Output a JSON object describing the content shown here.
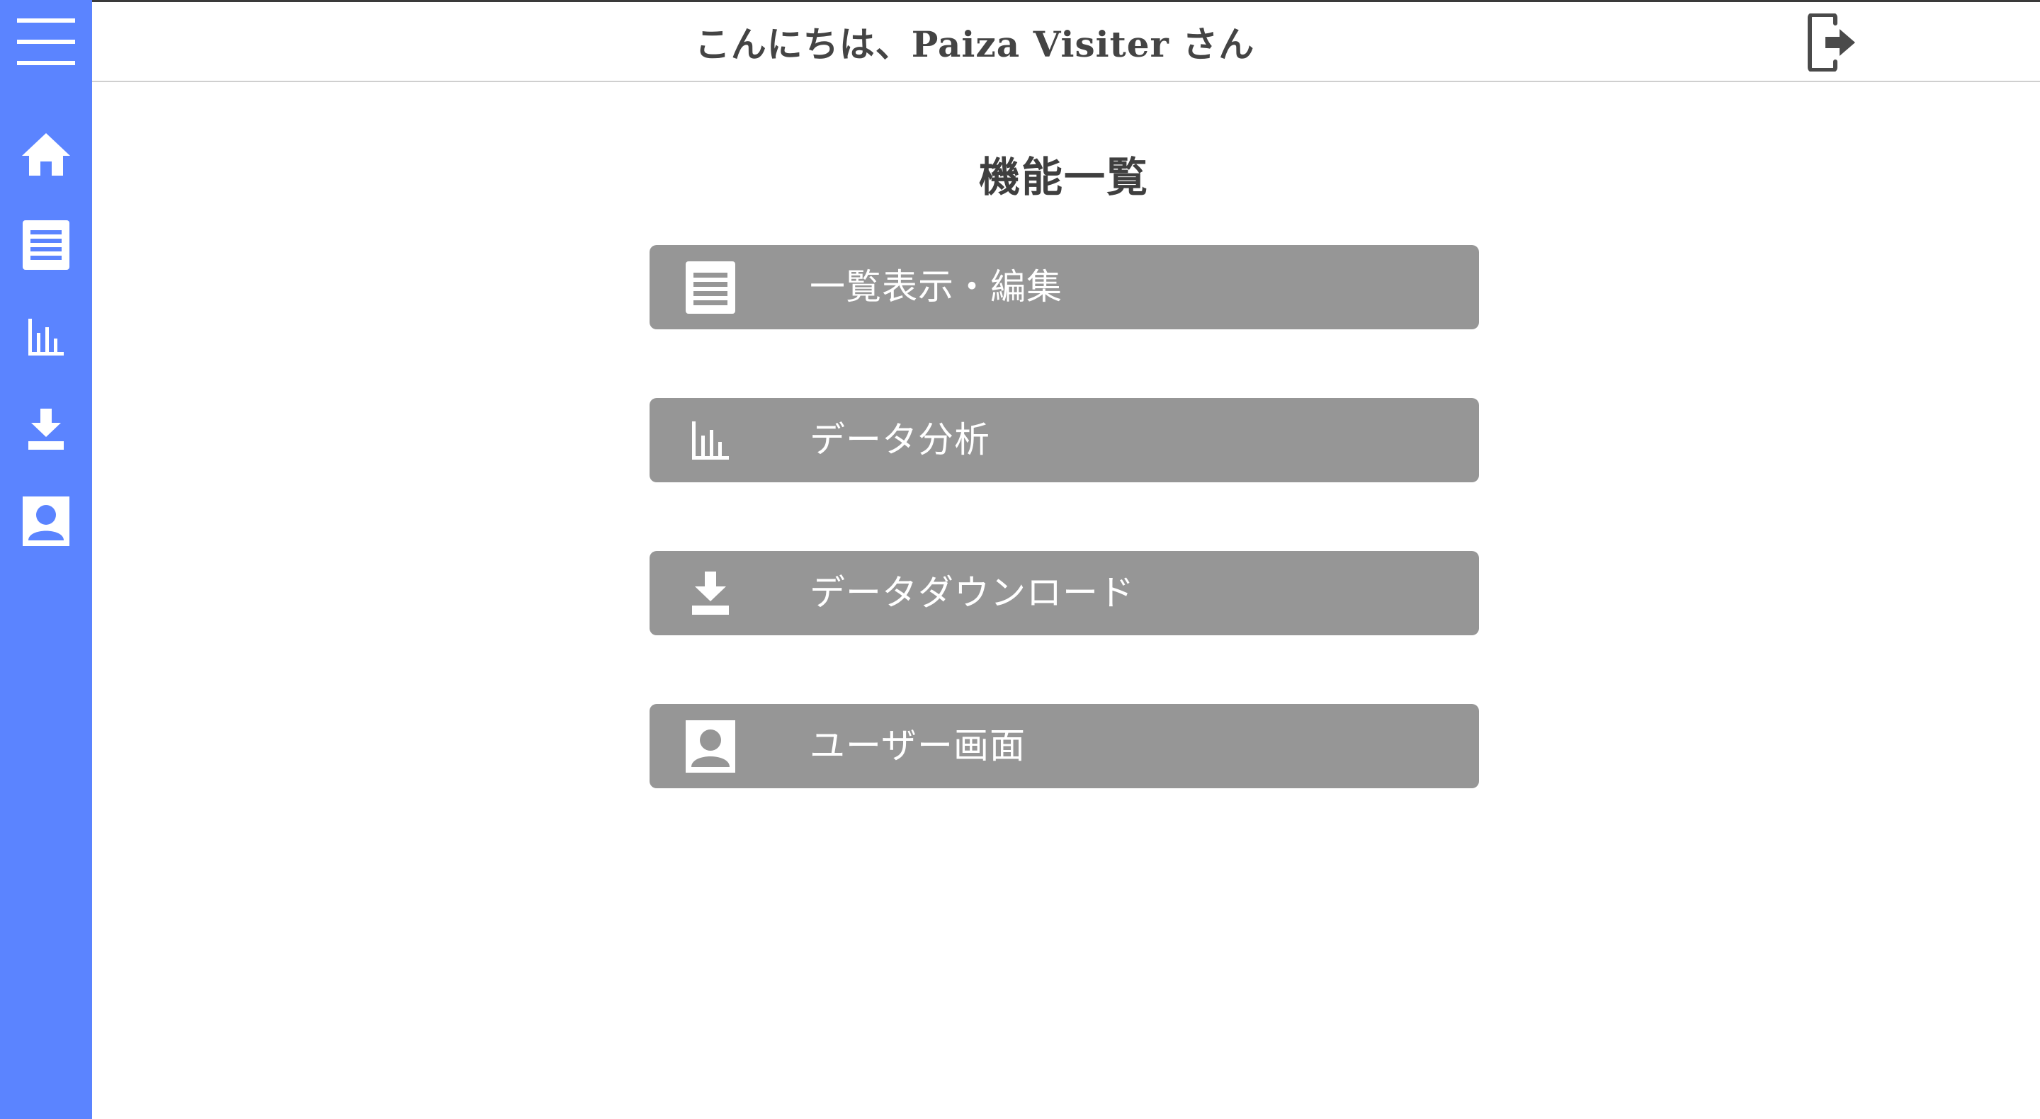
{
  "header": {
    "greeting": "こんにちは、Paiza Visiter さん",
    "logout_icon": "logout-icon"
  },
  "sidebar": {
    "items": [
      {
        "icon": "hamburger-menu-icon"
      },
      {
        "icon": "home-icon"
      },
      {
        "icon": "list-icon"
      },
      {
        "icon": "bar-chart-icon"
      },
      {
        "icon": "download-icon"
      },
      {
        "icon": "user-icon"
      }
    ]
  },
  "main": {
    "title": "機能一覧",
    "buttons": [
      {
        "icon": "list-icon",
        "label": "一覧表示・編集"
      },
      {
        "icon": "bar-chart-icon",
        "label": "データ分析"
      },
      {
        "icon": "download-icon",
        "label": "データダウンロード"
      },
      {
        "icon": "user-icon",
        "label": "ユーザー画面"
      }
    ]
  },
  "colors": {
    "sidebar": "#5b84ff",
    "button": "#969696",
    "text": "#444444"
  }
}
